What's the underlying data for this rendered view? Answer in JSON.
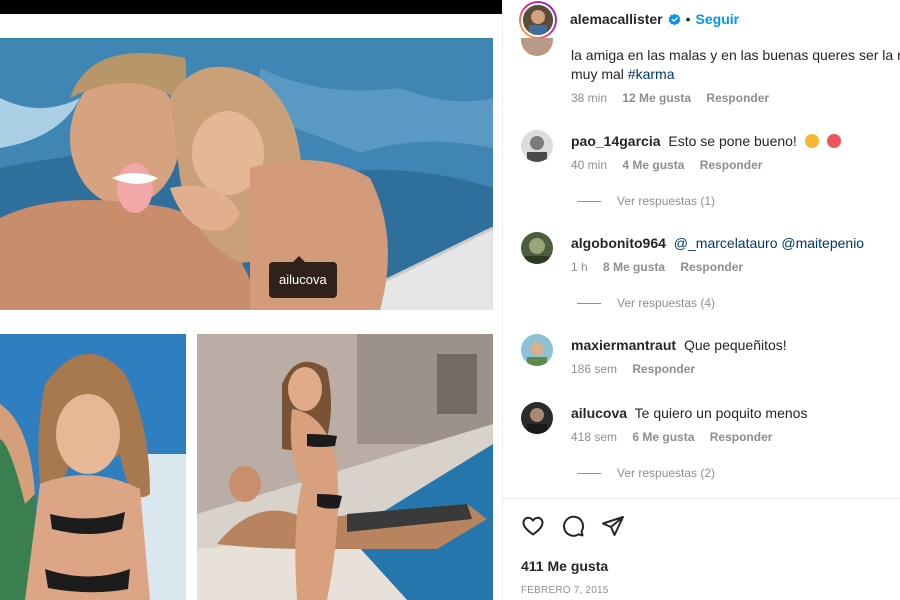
{
  "media": {
    "photo_tag": "ailucova"
  },
  "header": {
    "username": "alemacallister",
    "separator": "•",
    "follow_label": "Seguir"
  },
  "comments": {
    "first": {
      "text": "la amiga en las malas y en las buenas queres ser la n",
      "text2": "muy mal ",
      "hashtag": "#karma",
      "time": "38 min",
      "likes": "12 Me gusta",
      "reply": "Responder"
    },
    "items": [
      {
        "user": "pao_14garcia",
        "text": "Esto se pone bueno!",
        "time": "40 min",
        "likes": "4 Me gusta",
        "reply": "Responder",
        "view_replies": "Ver respuestas (1)"
      },
      {
        "user": "algobonito964",
        "mention1": "@_marcelatauro",
        "mention2": "@maitepenio",
        "time": "1 h",
        "likes": "8 Me gusta",
        "reply": "Responder",
        "view_replies": "Ver respuestas (4)"
      },
      {
        "user": "maxiermantraut",
        "text": "Que pequeñitos!",
        "time": "186 sem",
        "reply": "Responder"
      },
      {
        "user": "ailucova",
        "text": "Te quiero un poquito menos",
        "time": "418 sem",
        "likes": "6 Me gusta",
        "reply": "Responder",
        "view_replies": "Ver respuestas (2)"
      }
    ]
  },
  "footer": {
    "likes": "411 Me gusta",
    "date": "FEBRERO 7, 2015"
  },
  "icons": {
    "like": "heart-icon",
    "comment": "comment-icon",
    "share": "paper-plane-icon",
    "verified": "verified-badge-icon"
  },
  "colors": {
    "link_blue": "#0095f6",
    "mention_blue": "#00376b",
    "meta_gray": "#8e8e8e",
    "text": "#262626"
  }
}
